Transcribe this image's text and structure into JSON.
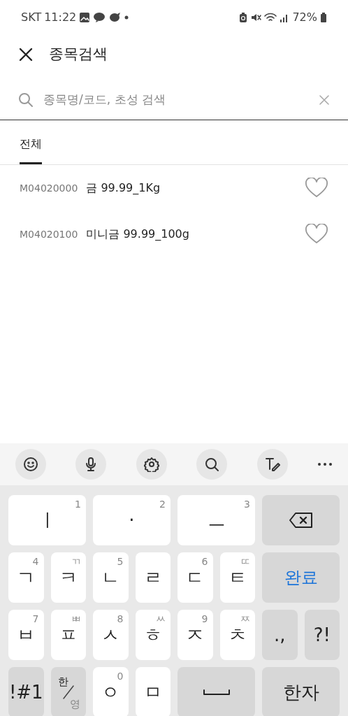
{
  "status_bar": {
    "carrier": "SKT",
    "time": "11:22",
    "battery": "72%"
  },
  "header": {
    "title": "종목검색"
  },
  "search": {
    "placeholder": "종목명/코드, 초성 검색"
  },
  "tabs": [
    {
      "label": "전체",
      "selected": true
    }
  ],
  "results": [
    {
      "code": "M04020000",
      "name": "금 99.99_1Kg",
      "favorite": false
    },
    {
      "code": "M04020100",
      "name": "미니금 99.99_100g",
      "favorite": false
    }
  ],
  "keyboard": {
    "rows": [
      {
        "keys": [
          {
            "kind": "letter",
            "main": "ㅣ",
            "sub": "1"
          },
          {
            "kind": "letter",
            "main": "·",
            "sub": "2"
          },
          {
            "kind": "letter",
            "main": "ㅡ",
            "sub": "3"
          },
          {
            "kind": "backspace"
          }
        ]
      },
      {
        "keys": [
          {
            "kind": "letter",
            "main": "ㄱ",
            "sub": "4"
          },
          {
            "kind": "letter",
            "main": "ㅋ",
            "sub": "ㄲ"
          },
          {
            "kind": "letter",
            "main": "ㄴ",
            "sub": "5"
          },
          {
            "kind": "letter",
            "main": "ㄹ"
          },
          {
            "kind": "letter",
            "main": "ㄷ",
            "sub": "6"
          },
          {
            "kind": "letter",
            "main": "ㅌ",
            "sub": "ㄸ"
          },
          {
            "kind": "done",
            "main": "완료"
          }
        ]
      },
      {
        "keys": [
          {
            "kind": "letter",
            "main": "ㅂ",
            "sub": "7"
          },
          {
            "kind": "letter",
            "main": "ㅍ",
            "sub": "ㅃ"
          },
          {
            "kind": "letter",
            "main": "ㅅ",
            "sub": "8"
          },
          {
            "kind": "letter",
            "main": "ㅎ",
            "sub": "ㅆ"
          },
          {
            "kind": "letter",
            "main": "ㅈ",
            "sub": "9"
          },
          {
            "kind": "letter",
            "main": "ㅊ",
            "sub": "ㅉ"
          },
          {
            "kind": "function",
            "main": ".,"
          },
          {
            "kind": "function",
            "main": "?!"
          }
        ]
      },
      {
        "keys": [
          {
            "kind": "function",
            "main": "!#1"
          },
          {
            "kind": "lang",
            "main": "한",
            "sub": "영"
          },
          {
            "kind": "letter",
            "main": "ㅇ",
            "sub": "0"
          },
          {
            "kind": "letter",
            "main": "ㅁ"
          },
          {
            "kind": "space"
          },
          {
            "kind": "conversion",
            "main": "한자"
          }
        ]
      }
    ]
  }
}
